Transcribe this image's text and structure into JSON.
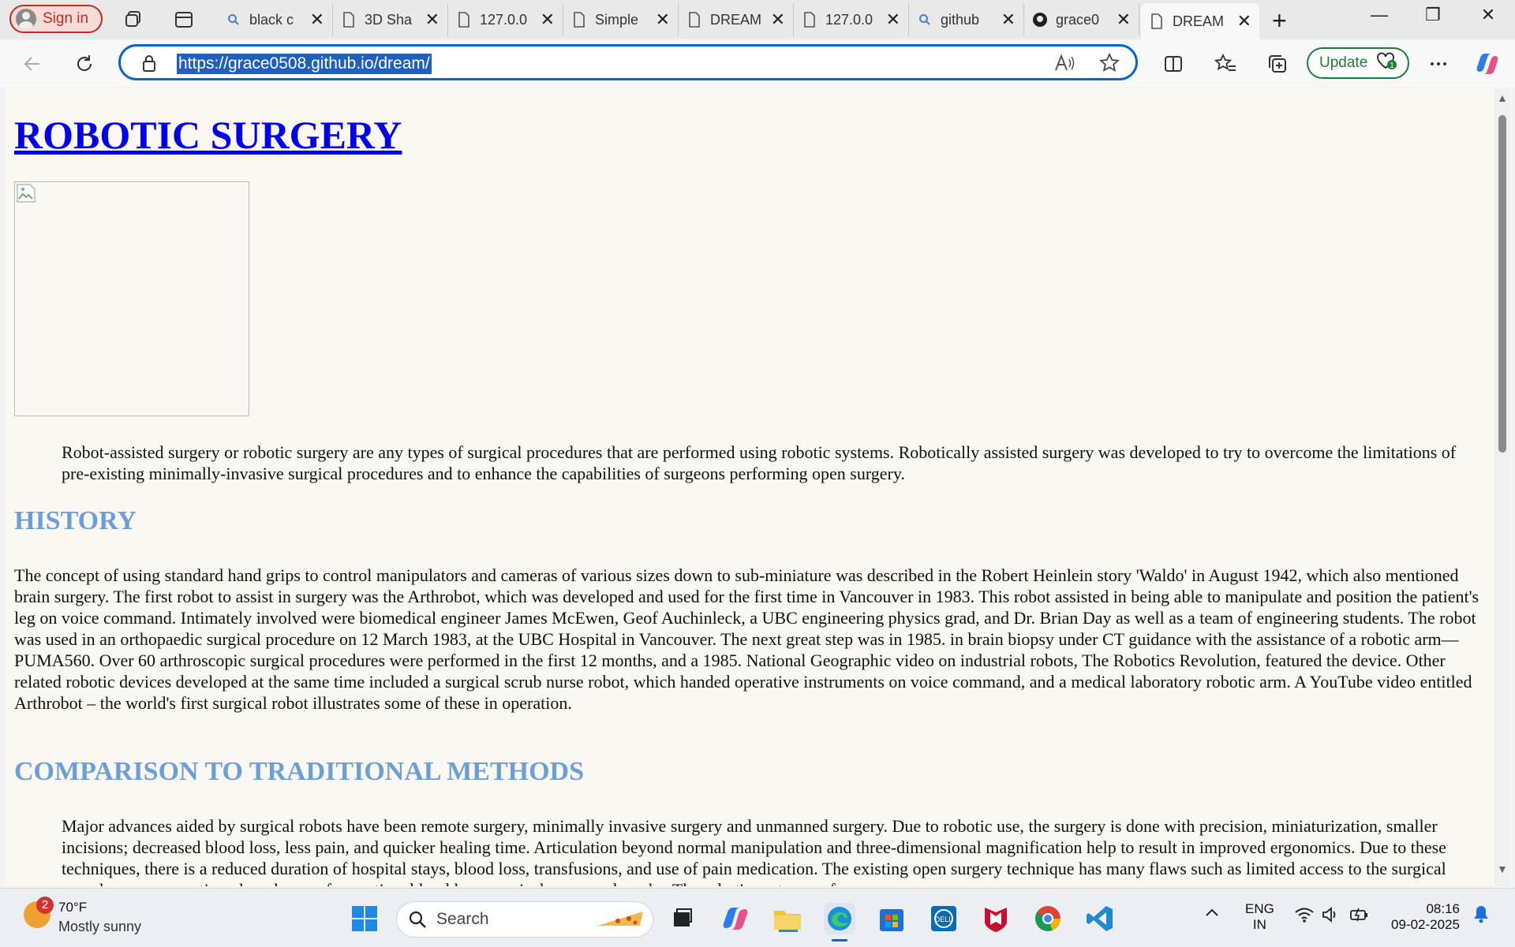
{
  "browser": {
    "signin_label": "Sign in",
    "tabs": [
      {
        "label": "black c",
        "icon": "search-icon"
      },
      {
        "label": "3D Sha",
        "icon": "page-icon"
      },
      {
        "label": "127.0.0",
        "icon": "page-icon"
      },
      {
        "label": "Simple",
        "icon": "page-icon"
      },
      {
        "label": "DREAM",
        "icon": "page-icon"
      },
      {
        "label": "127.0.0",
        "icon": "page-icon"
      },
      {
        "label": "github",
        "icon": "search-icon"
      },
      {
        "label": "grace0",
        "icon": "github-icon"
      },
      {
        "label": "DREAM",
        "icon": "page-icon",
        "active": true
      }
    ],
    "address_url": "https://grace0508.github.io/dream/",
    "update_label": "Update"
  },
  "page": {
    "title": "ROBOTIC SURGERY",
    "intro": "Robot-assisted surgery or robotic surgery are any types of surgical procedures that are performed using robotic systems. Robotically assisted surgery was developed to try to overcome the limitations of pre-existing minimally-invasive surgical procedures and to enhance the capabilities of surgeons performing open surgery.",
    "history_heading": "HISTORY",
    "history_text": "The concept of using standard hand grips to control manipulators and cameras of various sizes down to sub-miniature was described in the Robert Heinlein story 'Waldo' in August 1942, which also mentioned brain surgery. The first robot to assist in surgery was the Arthrobot, which was developed and used for the first time in Vancouver in 1983. This robot assisted in being able to manipulate and position the patient's leg on voice command. Intimately involved were biomedical engineer James McEwen, Geof Auchinleck, a UBC engineering physics grad, and Dr. Brian Day as well as a team of engineering students. The robot was used in an orthopaedic surgical procedure on 12 March 1983, at the UBC Hospital in Vancouver. The next great step was in 1985. in brain biopsy under CT guidance with the assistance of a robotic arm—PUMA560. Over 60 arthroscopic surgical procedures were performed in the first 12 months, and a 1985. National Geographic video on industrial robots, The Robotics Revolution, featured the device. Other related robotic devices developed at the same time included a surgical scrub nurse robot, which handed operative instruments on voice command, and a medical laboratory robotic arm. A YouTube video entitled Arthrobot – the world's first surgical robot illustrates some of these in operation.",
    "comparison_heading": "COMPARISON TO TRADITIONAL METHODS",
    "comparison_text": "Major advances aided by surgical robots have been remote surgery, minimally invasive surgery and unmanned surgery. Due to robotic use, the surgery is done with precision, miniaturization, smaller incisions; decreased blood loss, less pain, and quicker healing time. Articulation beyond normal manipulation and three-dimensional magnification help to result in improved ergonomics. Due to these techniques, there is a reduced duration of hospital stays, blood loss, transfusions, and use of pain medication. The existing open surgery technique has many flaws such as limited access to the surgical area, long recovery time, long hours of operation, blood loss, surgical scars, and marks. The robot's cost range from"
  },
  "taskbar": {
    "weather_temp": "70°F",
    "weather_condition": "Mostly sunny",
    "weather_badge": "2",
    "search_label": "Search",
    "lang_top": "ENG",
    "lang_bottom": "IN",
    "time": "08:16",
    "date": "09-02-2025"
  }
}
